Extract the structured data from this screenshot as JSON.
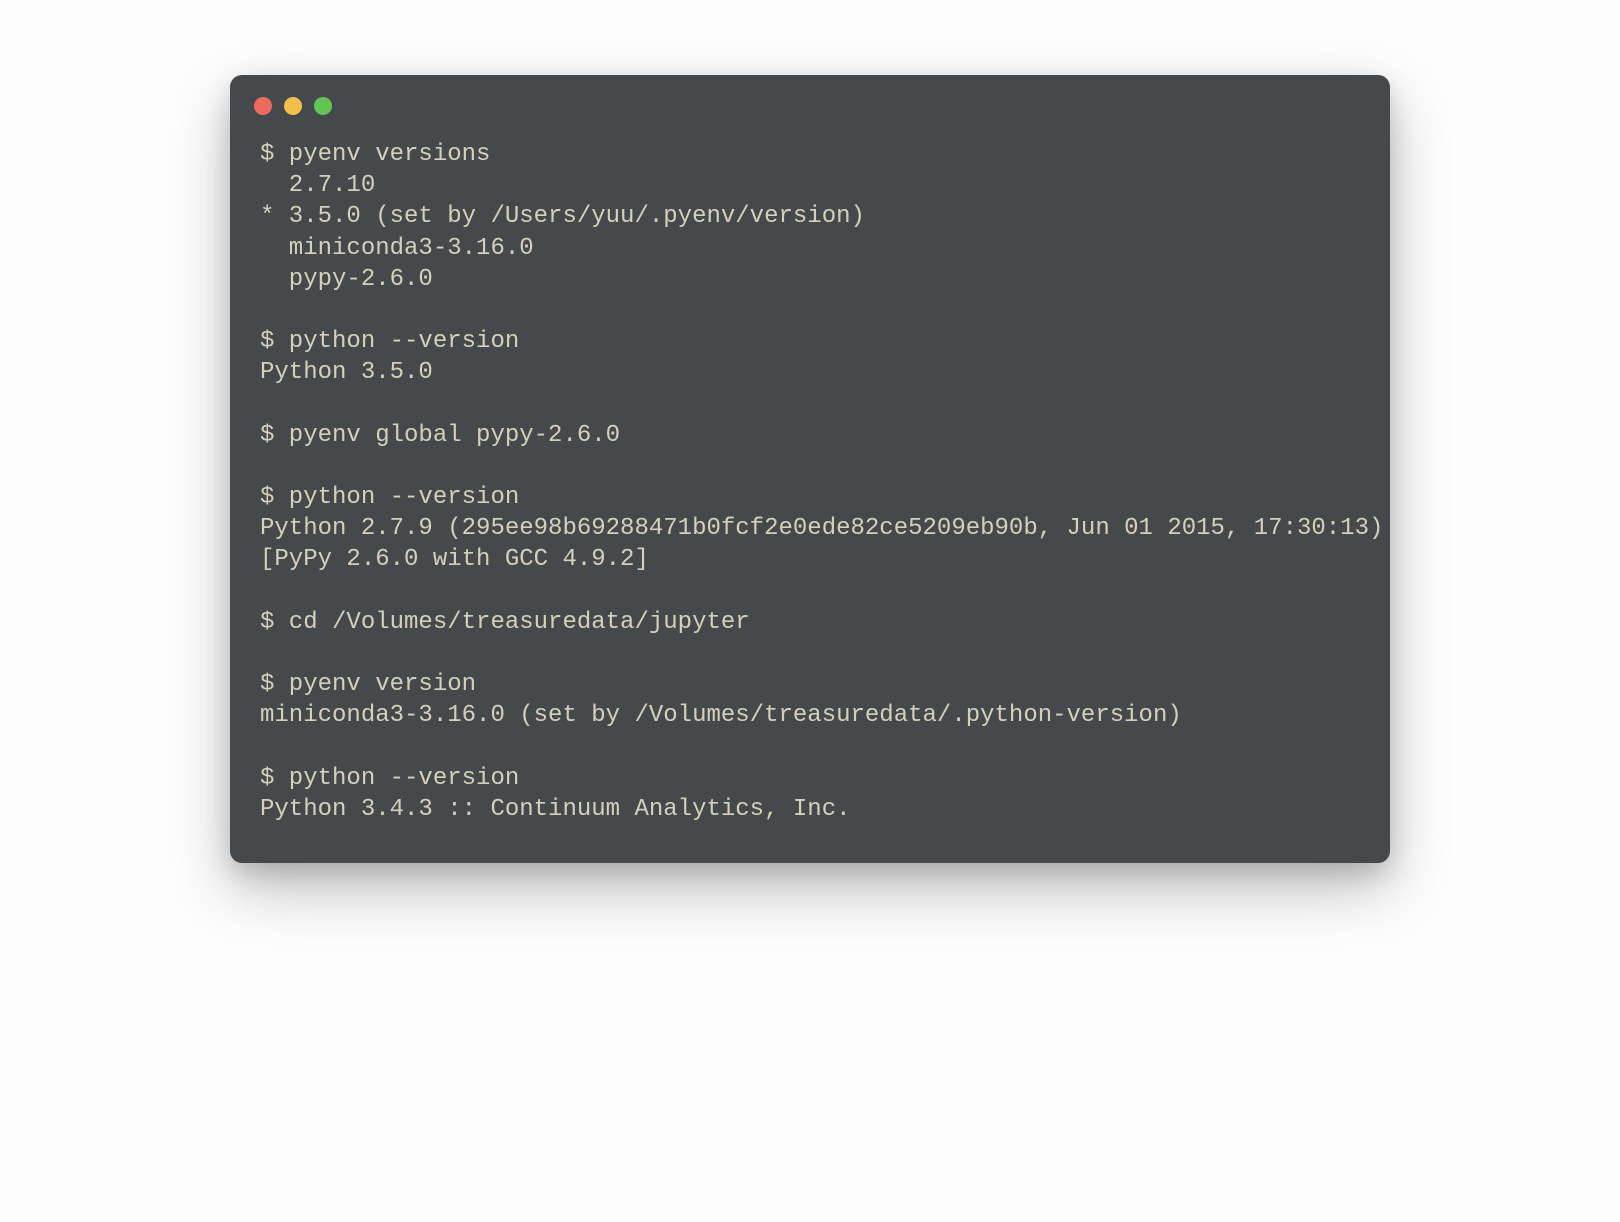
{
  "colors": {
    "window_bg": "#45494c",
    "text": "#d5d0b9",
    "dot_close": "#ec6a5e",
    "dot_min": "#f4be4f",
    "dot_max": "#61c454"
  },
  "terminal": {
    "lines": [
      "$ pyenv versions",
      "  2.7.10",
      "* 3.5.0 (set by /Users/yuu/.pyenv/version)",
      "  miniconda3-3.16.0",
      "  pypy-2.6.0",
      "",
      "$ python --version",
      "Python 3.5.0",
      "",
      "$ pyenv global pypy-2.6.0",
      "",
      "$ python --version",
      "Python 2.7.9 (295ee98b69288471b0fcf2e0ede82ce5209eb90b, Jun 01 2015, 17:30:13)",
      "[PyPy 2.6.0 with GCC 4.9.2]",
      "",
      "$ cd /Volumes/treasuredata/jupyter",
      "",
      "$ pyenv version",
      "miniconda3-3.16.0 (set by /Volumes/treasuredata/.python-version)",
      "",
      "$ python --version",
      "Python 3.4.3 :: Continuum Analytics, Inc."
    ]
  }
}
